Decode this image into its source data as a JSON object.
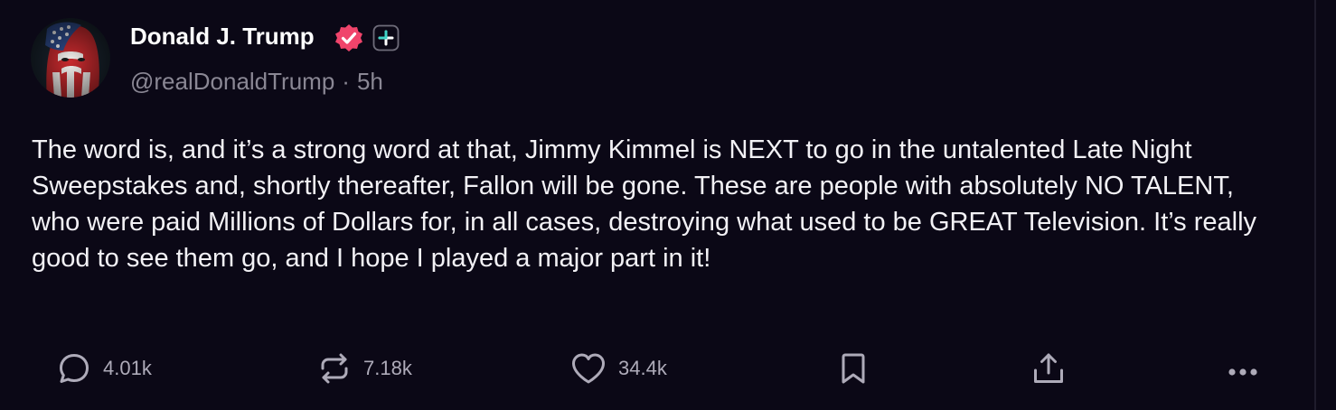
{
  "post": {
    "author": {
      "display_name": "Donald J. Trump",
      "handle": "@realDonaldTrump",
      "separator": "·",
      "time_ago": "5h",
      "verified": true,
      "avatar_icon": "flag-portrait-avatar",
      "badge_color": "#f0446b"
    },
    "body": "The word is, and it’s a strong word at that, Jimmy Kimmel is NEXT to go in the untalented Late Night Sweepstakes and, shortly thereafter, Fallon will be gone. These are people with absolutely NO TALENT, who were paid Millions of Dollars for, in all cases, destroying what used to be GREAT Television. It’s really good to see them go, and I hope I played a major part in it!",
    "actions": {
      "reply": {
        "icon": "reply-icon",
        "count": "4.01k"
      },
      "repost": {
        "icon": "repost-icon",
        "count": "7.18k"
      },
      "like": {
        "icon": "heart-icon",
        "count": "34.4k"
      },
      "bookmark": {
        "icon": "bookmark-icon"
      },
      "share": {
        "icon": "share-icon"
      },
      "more": {
        "icon": "more-icon"
      }
    }
  },
  "colors": {
    "background": "#0b0816",
    "text": "#f2f1f5",
    "muted": "#8a8794",
    "action": "#aeabb9"
  }
}
